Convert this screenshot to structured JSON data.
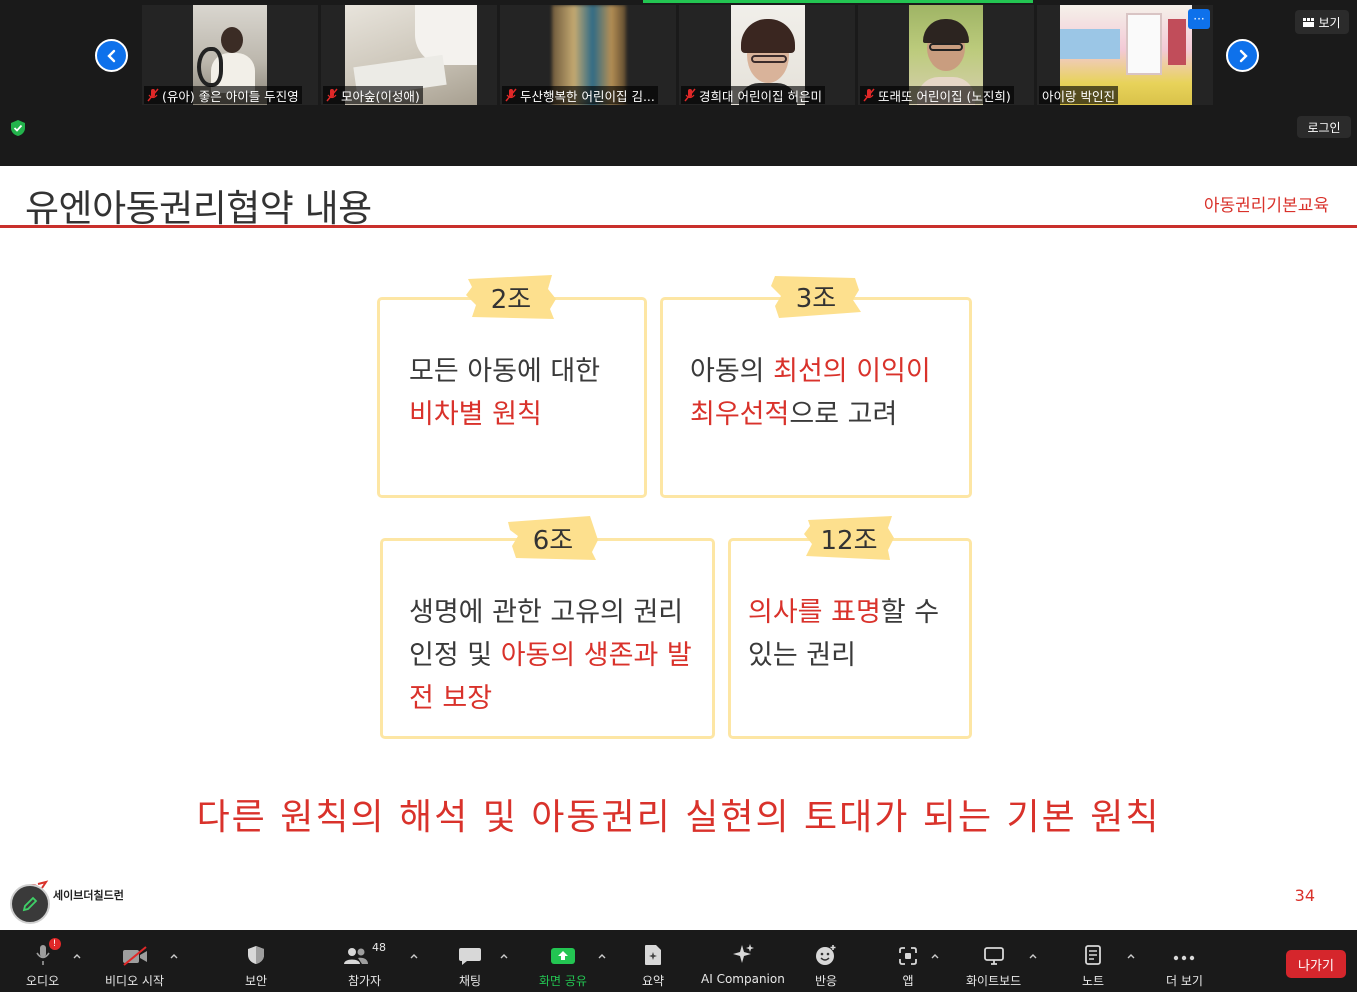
{
  "gallery": {
    "participants": [
      {
        "name": "(유아) 좋은 아이들 두진영",
        "muted": true
      },
      {
        "name": "모아숲(이성애)",
        "muted": true
      },
      {
        "name": "두산행복한 어린이집 김...",
        "muted": true
      },
      {
        "name": "경희대 어린이집 허은미",
        "muted": true
      },
      {
        "name": "또래또 어린이집 (노진희)",
        "muted": true
      },
      {
        "name": "아이랑 박인진",
        "muted": false
      }
    ],
    "menu_label": "···",
    "view_label": "보기",
    "login_label": "로그인"
  },
  "slide": {
    "title": "유엔아동권리협약 내용",
    "tag": "아동권리기본교육",
    "cards": [
      {
        "article": "2조",
        "lines": [
          [
            {
              "t": "모든 아동에 대한",
              "red": false
            }
          ],
          [
            {
              "t": "비차별 원칙",
              "red": true
            }
          ]
        ]
      },
      {
        "article": "3조",
        "lines": [
          [
            {
              "t": "아동의 ",
              "red": false
            },
            {
              "t": "최선의 이익이",
              "red": true
            }
          ],
          [
            {
              "t": "최우선적",
              "red": true
            },
            {
              "t": "으로 고려",
              "red": false
            }
          ]
        ]
      },
      {
        "article": "6조",
        "lines": [
          [
            {
              "t": "생명에 관한 고유의 권리",
              "red": false
            }
          ],
          [
            {
              "t": "인정 및 ",
              "red": false
            },
            {
              "t": "아동의 생존과 발",
              "red": true
            }
          ],
          [
            {
              "t": "전 보장",
              "red": true
            }
          ]
        ]
      },
      {
        "article": "12조",
        "lines": [
          [
            {
              "t": "의사를 표명",
              "red": true
            },
            {
              "t": "할 수",
              "red": false
            }
          ],
          [
            {
              "t": "있는 권리",
              "red": false
            }
          ]
        ]
      }
    ],
    "footer": "다른 원칙의 해석 및 아동권리 실현의 토대가 되는 기본 원칙",
    "brand": "세이브더칠드런",
    "page_number": "34"
  },
  "toolbar": {
    "audio": "오디오",
    "video": "비디오 시작",
    "security": "보안",
    "participants": "참가자",
    "participants_count": "48",
    "chat": "채팅",
    "share": "화면 공유",
    "summary": "요약",
    "ai": "AI Companion",
    "reactions": "반응",
    "apps": "앱",
    "whiteboard": "화이트보드",
    "notes": "노트",
    "more": "더 보기",
    "leave": "나가기"
  },
  "colors": {
    "accent_red": "#d9322b",
    "card_border": "#fde6a4",
    "tape": "#fde08e",
    "zoom_blue": "#0e71eb",
    "share_green": "#23c552",
    "leave_red": "#d5262c"
  }
}
